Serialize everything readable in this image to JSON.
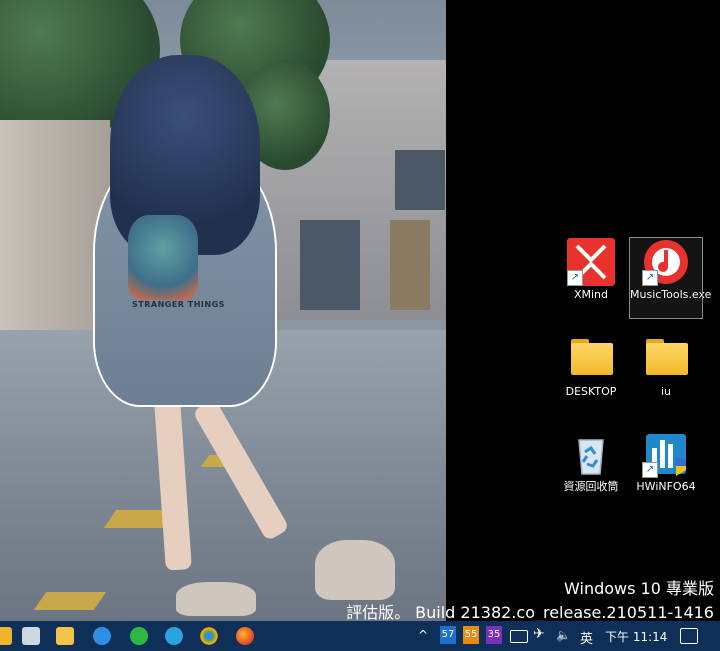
{
  "desktop_icons": [
    {
      "label": "XMind",
      "icon": "xmind-icon"
    },
    {
      "label": "MusicTools.exe",
      "icon": "music-icon",
      "selected": true
    },
    {
      "label": "DESKTOP",
      "icon": "folder-icon"
    },
    {
      "label": "iu",
      "icon": "folder-icon"
    },
    {
      "label": "資源回收筒",
      "icon": "recycle-bin-icon"
    },
    {
      "label": "HWiNFO64",
      "icon": "hwinfo-icon"
    }
  ],
  "watermark": {
    "line1": "Windows 10 專業版",
    "line2": "評估版。 Build 21382.co_release.210511-1416"
  },
  "wallpaper": {
    "print_text": "STRANGER THINGS"
  },
  "taskbar": {
    "tray_chevron": "^",
    "badge_1": "57",
    "badge_2": "55",
    "badge_3": "35",
    "ime": "英",
    "clock": "下午 11:14",
    "colors": {
      "bg": "#0d2f58",
      "badge_1": "#1f6fd1",
      "badge_2": "#e98a12",
      "badge_3": "#7a2fbf"
    }
  }
}
